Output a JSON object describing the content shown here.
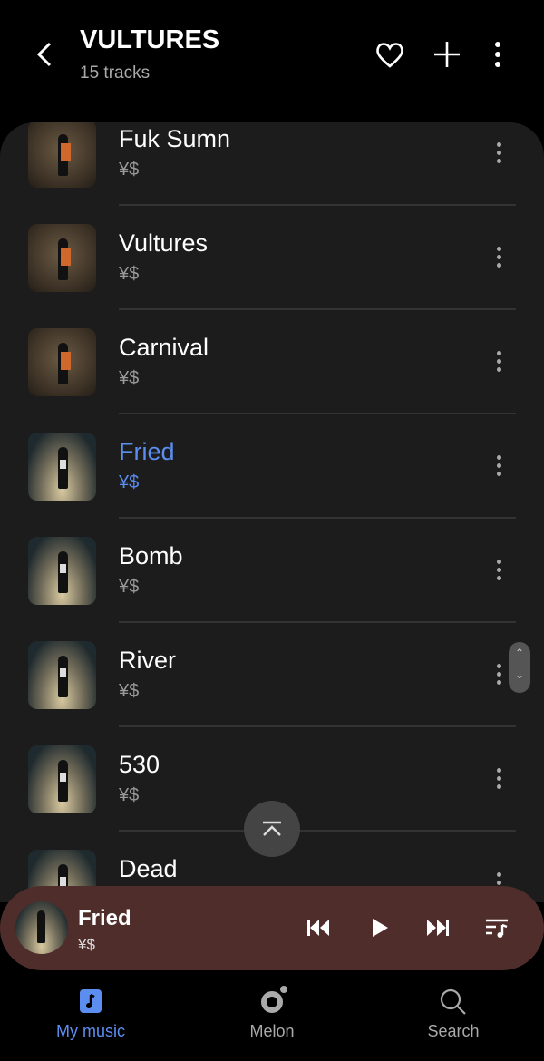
{
  "header": {
    "title": "VULTURES",
    "subtitle": "15 tracks"
  },
  "tracks": [
    {
      "title": "Fuk Sumn",
      "artist": "¥$",
      "art": "orange"
    },
    {
      "title": "Vultures",
      "artist": "¥$",
      "art": "orange"
    },
    {
      "title": "Carnival",
      "artist": "¥$",
      "art": "orange"
    },
    {
      "title": "Fried",
      "artist": "¥$",
      "art": "light",
      "playing": true
    },
    {
      "title": "Bomb",
      "artist": "¥$",
      "art": "light"
    },
    {
      "title": "River",
      "artist": "¥$",
      "art": "light"
    },
    {
      "title": "530",
      "artist": "¥$",
      "art": "light"
    },
    {
      "title": "Dead",
      "artist": "¥$",
      "art": "light"
    }
  ],
  "mini_player": {
    "title": "Fried",
    "artist": "¥$",
    "background": "#4f2d2b"
  },
  "nav": [
    {
      "label": "My music",
      "active": true
    },
    {
      "label": "Melon"
    },
    {
      "label": "Search"
    }
  ],
  "colors": {
    "accent": "#5b8ef0"
  }
}
